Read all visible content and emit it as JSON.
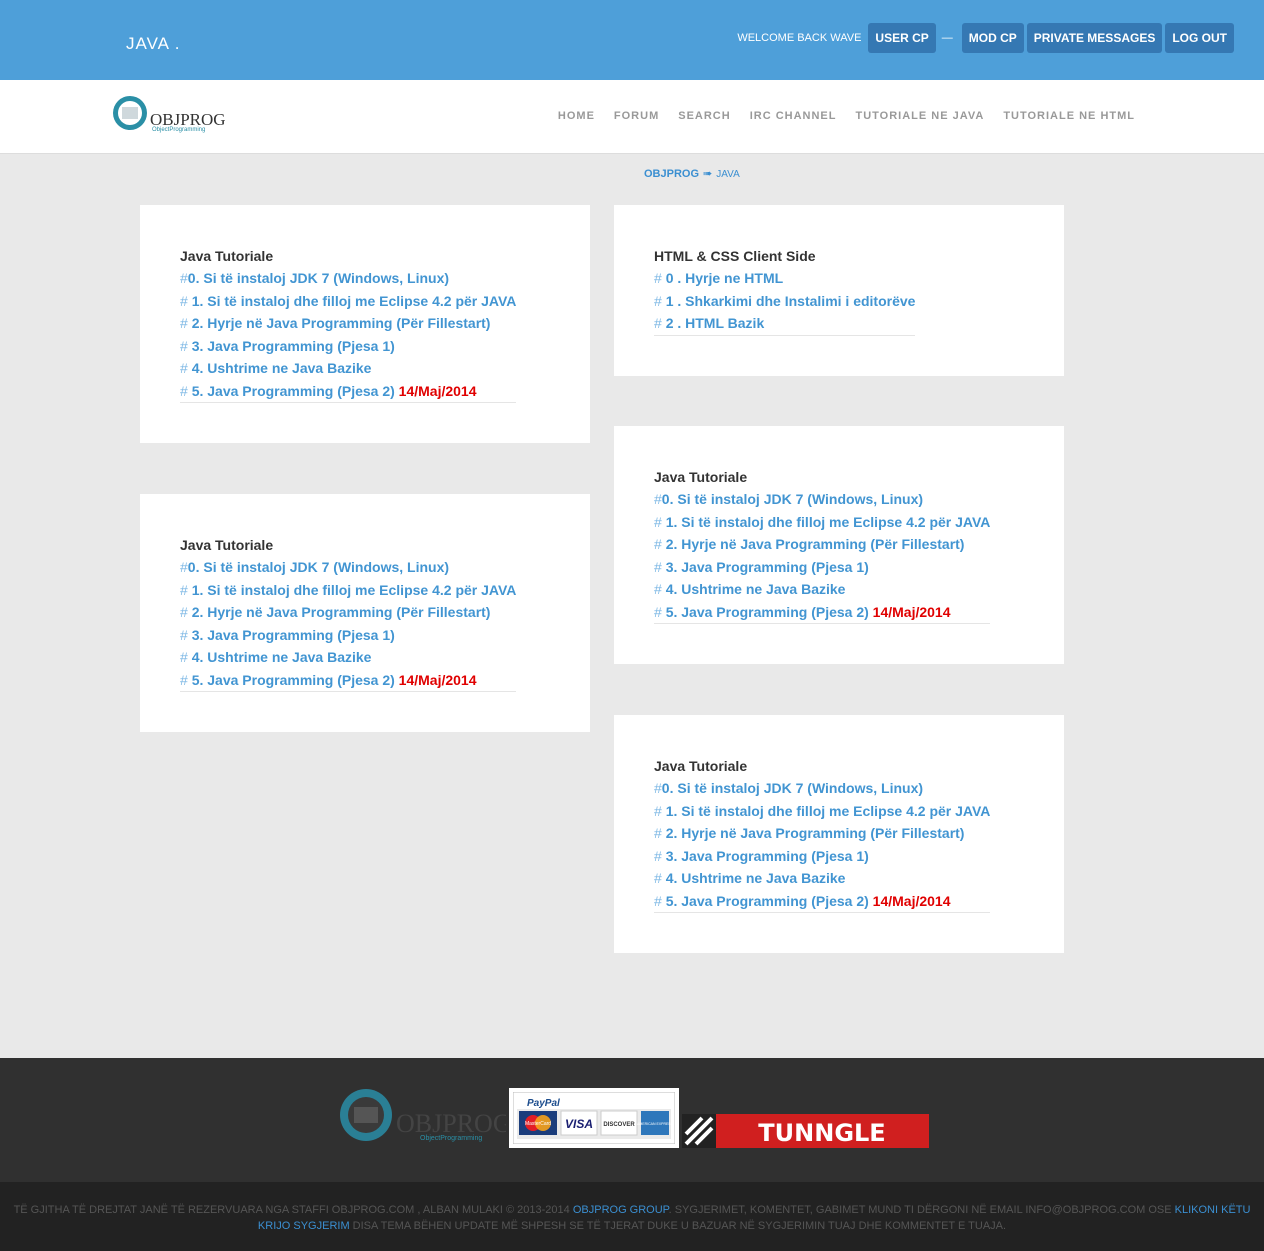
{
  "header": {
    "site_title": "JAVA .",
    "welcome": "WELCOME BACK WAVE",
    "separator": "—",
    "buttons": {
      "user_cp": "USER CP",
      "mod_cp": "MOD CP",
      "private_messages": "PRIVATE MESSAGES",
      "log_out": "LOG OUT"
    }
  },
  "logo": {
    "main": "OBJPROG",
    "sub": "ObjectProgramming"
  },
  "nav": {
    "home": "HOME",
    "forum": "FORUM",
    "search": "SEARCH",
    "irc": "IRC CHANNEL",
    "tut_java": "TUTORIALE NE JAVA",
    "tut_html": "TUTORIALE NE HTML"
  },
  "breadcrumb": {
    "root": "OBJPROG",
    "arrow": "➠",
    "current": "JAVA"
  },
  "java_card": {
    "title": "Java Tutoriale",
    "hash": "#",
    "items": [
      "0. Si të instaloj JDK 7 (Windows, Linux)",
      "1. Si të instaloj dhe filloj me Eclipse 4.2 për JAVA",
      "2. Hyrje në Java Programming (Për Fillestart)",
      "3. Java Programming (Pjesa 1)",
      "4. Ushtrime ne Java Bazike",
      "5. Java Programming (Pjesa 2)"
    ],
    "date": "14/Maj/2014"
  },
  "html_card": {
    "title": "HTML & CSS Client Side",
    "hash": "#",
    "items": [
      "0 . Hyrje ne HTML",
      "1 . Shkarkimi dhe Instalimi i editorëve",
      "2 . HTML Bazik"
    ]
  },
  "footer": {
    "paypal": "PayPal",
    "cards": [
      "MasterCard",
      "VISA",
      "DISCOVER",
      "AMERICAN EXPRESS"
    ],
    "tunngle": "TUNNGLE",
    "copyright_1": "TË GJITHA TË DREJTAT JANË TË REZERVUARA NGA STAFFI OBJPROG.COM , ALBAN MULAKI © 2013-2014",
    "group_link": "OBJPROG GROUP",
    "copyright_2": ". SYGJERIMET, KOMENTET, GABIMET MUND TI DËRGONI NË EMAIL INFO@OBJPROG.COM OSE",
    "suggest_link": "KLIKONI KËTU KRIJO SYGJERIM",
    "copyright_3": "DISA TEMA BËHEN UPDATE MË SHPESH SE TË TJERAT DUKE U BAZUAR NË SYGJERIMIN TUAJ DHE KOMMENTET E TUAJA."
  },
  "colors": {
    "topbar": "#4e9fd9",
    "link": "#4295d2",
    "date": "#e00000",
    "footer": "#303030"
  }
}
